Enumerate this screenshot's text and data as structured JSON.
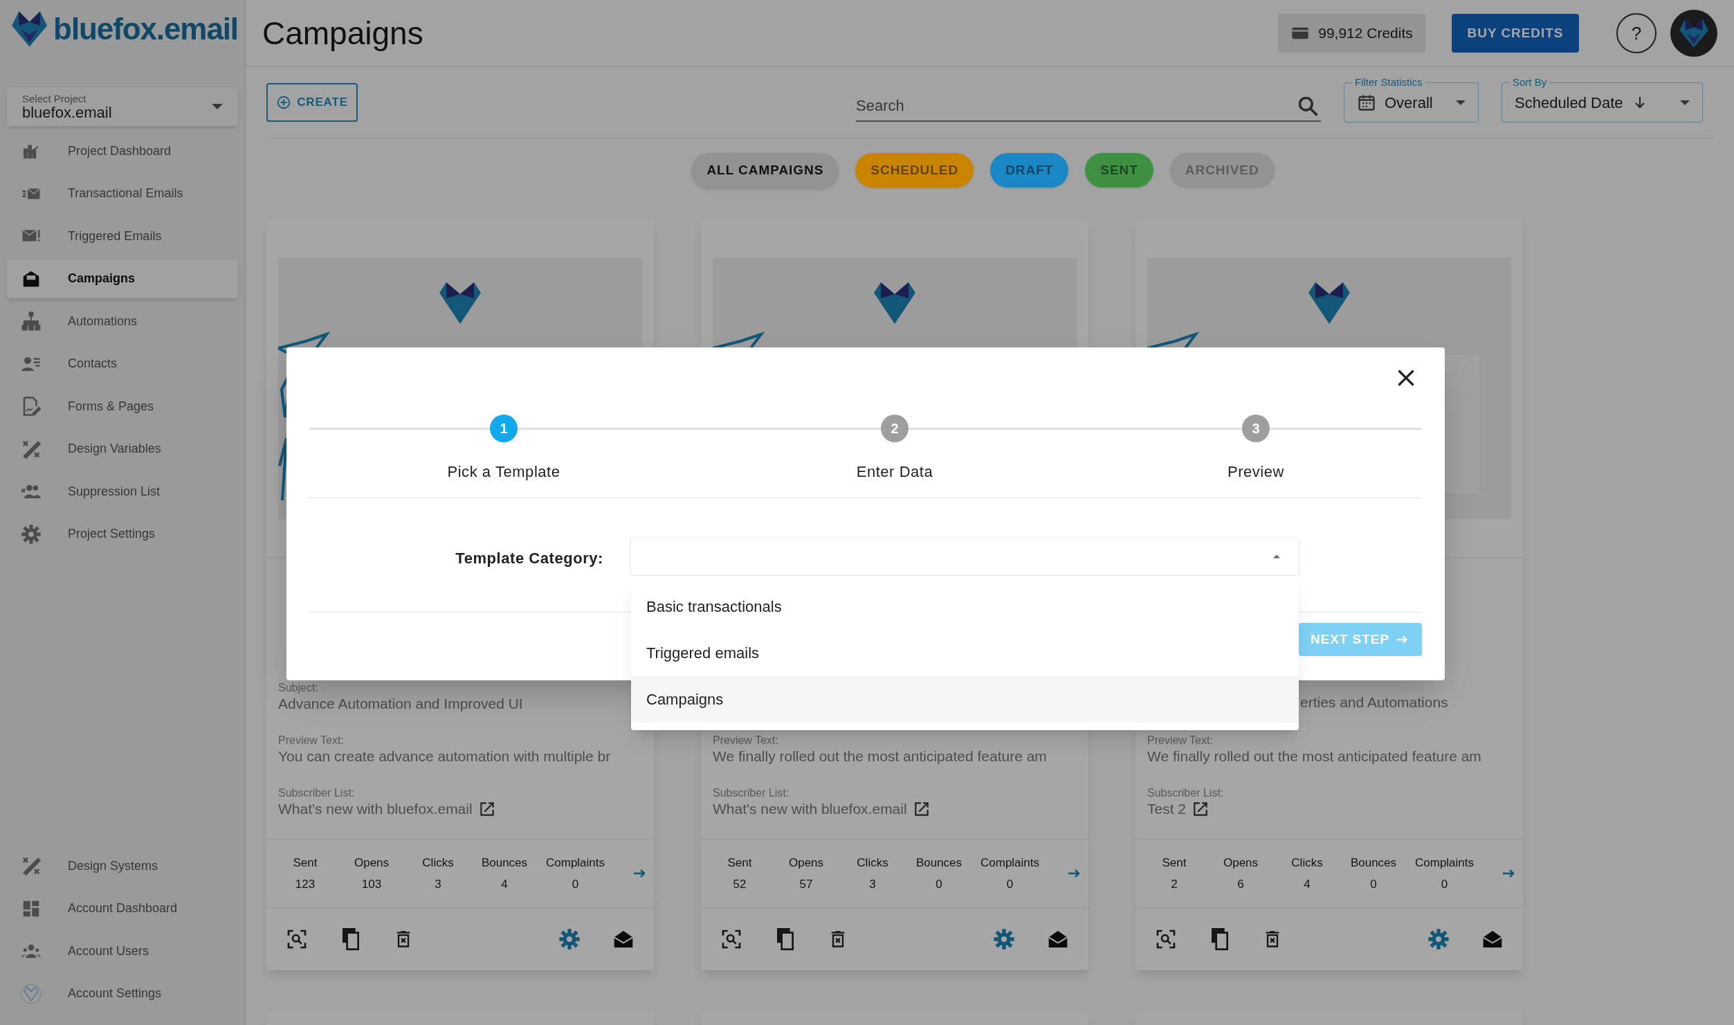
{
  "sidebar": {
    "logo": "bluefox.email",
    "project_select": {
      "label": "Select Project",
      "value": "bluefox.email"
    },
    "nav": [
      {
        "label": "Project Dashboard",
        "selected": false
      },
      {
        "label": "Transactional Emails",
        "selected": false
      },
      {
        "label": "Triggered Emails",
        "selected": false
      },
      {
        "label": "Campaigns",
        "selected": true
      },
      {
        "label": "Automations",
        "selected": false
      },
      {
        "label": "Contacts",
        "selected": false
      },
      {
        "label": "Forms & Pages",
        "selected": false
      },
      {
        "label": "Design Variables",
        "selected": false
      },
      {
        "label": "Suppression List",
        "selected": false
      },
      {
        "label": "Project Settings",
        "selected": false
      }
    ],
    "account_nav": [
      {
        "label": "Design Systems",
        "selected": false
      },
      {
        "label": "Account Dashboard",
        "selected": false
      },
      {
        "label": "Account Users",
        "selected": false
      },
      {
        "label": "Account Settings",
        "selected": false
      }
    ]
  },
  "header": {
    "title": "Campaigns",
    "credits": "99,912 Credits",
    "buy_button": "BUY CREDITS",
    "help": "?"
  },
  "toolbar": {
    "create_button": "CREATE",
    "search": {
      "placeholder": "Search"
    },
    "filter_statistics": {
      "label": "Filter Statistics",
      "value": "Overall"
    },
    "sort_by": {
      "label": "Sort By",
      "value": "Scheduled Date"
    }
  },
  "filter_chips": [
    {
      "label": "ALL CAMPAIGNS",
      "color": "#939393",
      "selected": true
    },
    {
      "label": "SCHEDULED",
      "color": "#c98400",
      "selected": false
    },
    {
      "label": "DRAFT",
      "color": "#1a88c4",
      "selected": false
    },
    {
      "label": "SENT",
      "color": "#3f9142",
      "selected": false
    },
    {
      "label": "ARCHIVED",
      "color": "#939393",
      "selected": false
    }
  ],
  "cards": [
    {
      "subject_label": "Subject:",
      "subject": "Advance Automation and Improved UI",
      "subject_cut": false,
      "preview_label": "Preview Text:",
      "preview": "You can create advance automation with multiple br",
      "list_label": "Subscriber List:",
      "list": "What's new with bluefox.email",
      "stats": [
        {
          "label": "Sent",
          "value": "123"
        },
        {
          "label": "Opens",
          "value": "103"
        },
        {
          "label": "Clicks",
          "value": "3"
        },
        {
          "label": "Bounces",
          "value": "4"
        },
        {
          "label": "Complaints",
          "value": "0"
        }
      ]
    },
    {
      "preview_label": "Preview Text:",
      "preview": "We finally rolled out the most anticipated feature am",
      "list_label": "Subscriber List:",
      "list": "What's new with bluefox.email",
      "stats": [
        {
          "label": "Sent",
          "value": "52"
        },
        {
          "label": "Opens",
          "value": "57"
        },
        {
          "label": "Clicks",
          "value": "3"
        },
        {
          "label": "Bounces",
          "value": "0"
        },
        {
          "label": "Complaints",
          "value": "0"
        }
      ]
    },
    {
      "subject": "erties and Automations",
      "subject_cut": true,
      "preview_label": "Preview Text:",
      "preview": "We finally rolled out the most anticipated feature am",
      "list_label": "Subscriber List:",
      "list": "Test 2",
      "stats": [
        {
          "label": "Sent",
          "value": "2"
        },
        {
          "label": "Opens",
          "value": "6"
        },
        {
          "label": "Clicks",
          "value": "4"
        },
        {
          "label": "Bounces",
          "value": "0"
        },
        {
          "label": "Complaints",
          "value": "0"
        }
      ]
    }
  ],
  "dialog": {
    "steps": [
      {
        "number": "1",
        "label": "Pick a Template",
        "selected": true
      },
      {
        "number": "2",
        "label": "Enter Data",
        "selected": false
      },
      {
        "number": "3",
        "label": "Preview",
        "selected": false
      }
    ],
    "template_category": {
      "label": "Template Category:",
      "expanded": true,
      "options": [
        {
          "label": "Basic transactionals",
          "selected": false
        },
        {
          "label": "Triggered emails",
          "selected": false
        },
        {
          "label": "Campaigns",
          "selected": true
        }
      ]
    },
    "next_button": {
      "label": "NEXT STEP",
      "disabled": true
    }
  }
}
